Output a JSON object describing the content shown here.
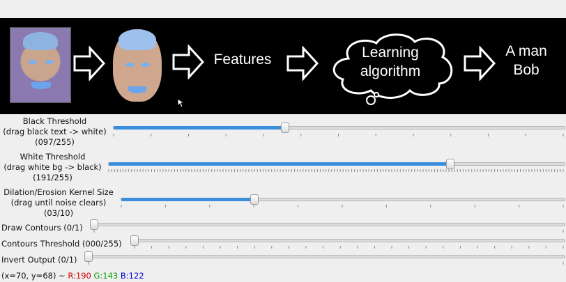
{
  "image_panel": {
    "step_features": "Features",
    "step_learning_line1": "Learning",
    "step_learning_line2": "algorithm",
    "output_line1": "A man",
    "output_line2": "Bob"
  },
  "sliders": [
    {
      "id": "black",
      "label_lines": [
        "Black Threshold",
        "(drag black text -> white)",
        "(097/255)"
      ],
      "value": 97,
      "max": 255
    },
    {
      "id": "white",
      "label_lines": [
        "White Threshold",
        "(drag white bg -> black)",
        "(191/255)"
      ],
      "value": 191,
      "max": 255
    },
    {
      "id": "kernel",
      "label_lines": [
        "Dilation/Erosion Kernel Size",
        "(drag until noise clears)",
        "(03/10)"
      ],
      "value": 3,
      "max": 10
    },
    {
      "id": "contours",
      "label": "Draw Contours (0/1)",
      "value": 0,
      "max": 1
    },
    {
      "id": "contour_threshold",
      "label": "Contours Threshold (000/255)",
      "value": 0,
      "max": 255
    },
    {
      "id": "invert",
      "label": "Invert Output (0/1)",
      "value": 0,
      "max": 1
    }
  ],
  "status": {
    "coords": "(x=70, y=68) ~",
    "r": "R:190",
    "g": "G:143",
    "b": "B:122",
    "colors": {
      "r": "#d40000",
      "g": "#00a000",
      "b": "#0000d0"
    }
  }
}
